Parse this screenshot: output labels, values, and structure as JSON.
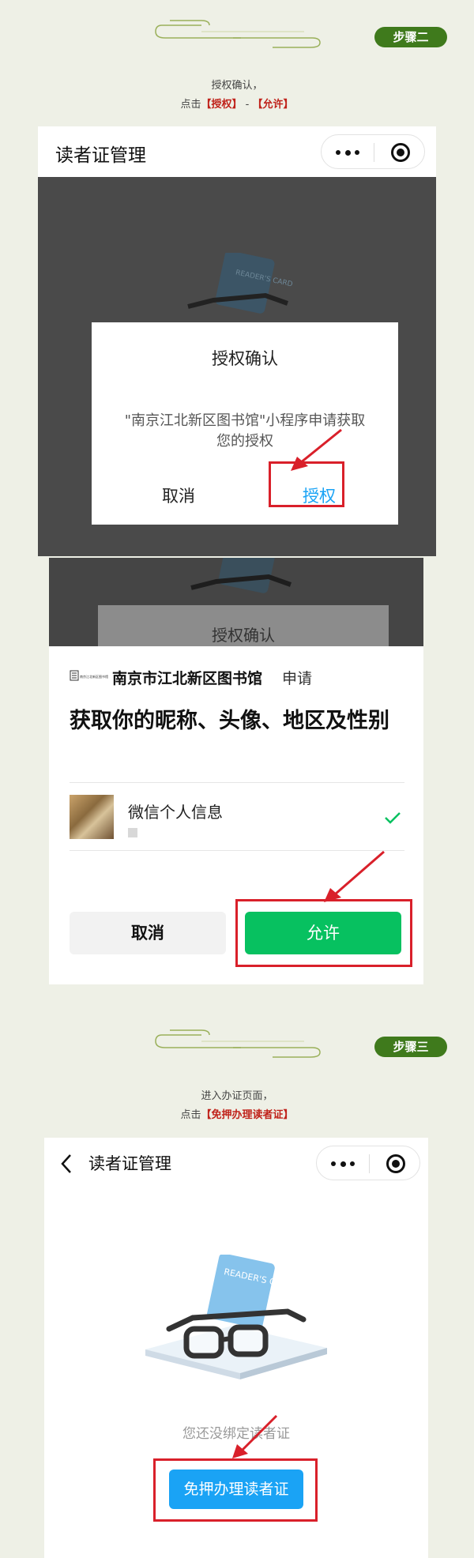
{
  "step2": {
    "badge": "步骤二",
    "line1": "授权确认，",
    "line2_prefix": "点击",
    "line2_a": "【授权】",
    "line2_sep": "-",
    "line2_b": "【允许】"
  },
  "screen1": {
    "title": "读者证管理",
    "card_art_text": "READER'S CARD",
    "dialog_title": "授权确认",
    "dialog_message_1": "\"南京江北新区图书馆\"小程序申请获取",
    "dialog_message_2": "您的授权",
    "cancel_label": "取消",
    "authorize_label": "授权"
  },
  "screen2": {
    "behind_title": "授权确认",
    "library_logo": "南京江北新区图书馆",
    "library_name": "南京市江北新区图书馆",
    "apply_label": "申请",
    "headline": "获取你的昵称、头像、地区及性别",
    "info_label": "微信个人信息",
    "cancel_label": "取消",
    "allow_label": "允许"
  },
  "step3": {
    "badge": "步骤三",
    "line1": "进入办证页面，",
    "line2_prefix": "点击",
    "line2_a": "【免押办理读者证】"
  },
  "screen3": {
    "title": "读者证管理",
    "card_art_text": "READER'S CARD",
    "empty_text": "您还没绑定读者证",
    "cta_label": "免押办理读者证"
  },
  "colors": {
    "page_bg": "#eef0e6",
    "badge_green": "#3f7a1c",
    "highlight_red": "#c0221a",
    "annotation_red": "#d9202a",
    "wechat_green": "#07c160",
    "action_blue": "#1aa3f5",
    "link_blue": "#1aa3f5"
  },
  "icons": [
    "more-dots-icon",
    "target-circle-icon",
    "back-arrow-icon",
    "check-icon",
    "glasses-card-illustration"
  ]
}
